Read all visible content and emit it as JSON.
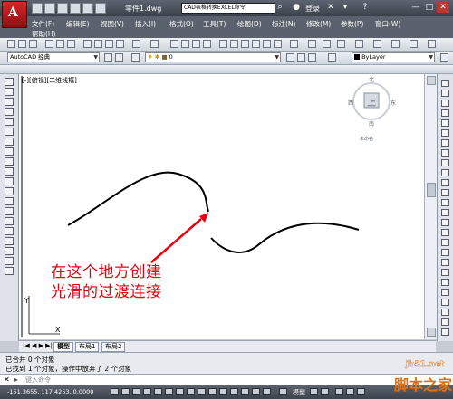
{
  "window": {
    "document_name": "零件1.dwg",
    "search_text": "CAD表格转换EXCEL命令",
    "login_label": "登录"
  },
  "menu": {
    "row1": [
      "文件(F)",
      "编辑(E)",
      "视图(V)",
      "插入(I)",
      "格式(O)",
      "工具(T)",
      "绘图(D)",
      "标注(N)",
      "修改(M)",
      "参数(P)",
      "窗口(W)"
    ],
    "row2": [
      "帮助(H)"
    ]
  },
  "toolbar": {
    "workspace": "AutoCAD 经典",
    "layer": "0",
    "color": "ByLayer"
  },
  "viewport": {
    "label": "[-][俯视][二维线框]"
  },
  "viewcube": {
    "north": "北",
    "south": "南",
    "east": "东",
    "west": "西",
    "top": "上",
    "wcs": "未命名"
  },
  "ucs": {
    "x": "X",
    "y": "Y"
  },
  "tabs": [
    "模型",
    "布局1",
    "布局2"
  ],
  "command": {
    "history_line1": "已合并 0 个对象",
    "history_line2": "已找到 1 个对象，操作中放弃了 2 个对象",
    "input_placeholder": "键入命令"
  },
  "status": {
    "coordinates": "-151.3655, 117.4253, 0.0000",
    "model": "模型"
  },
  "annotation": {
    "line1": "在这个地方创建",
    "line2": "光滑的过渡连接",
    "color": "#e8000f"
  },
  "watermark": {
    "url": "jb51.net",
    "text": "脚本之家"
  }
}
